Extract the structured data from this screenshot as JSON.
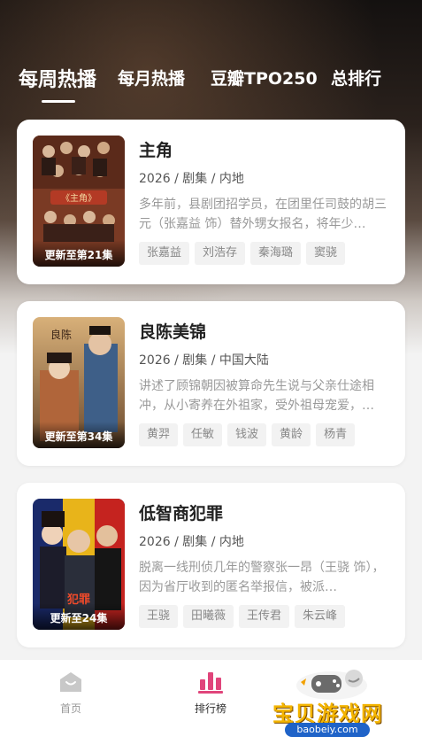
{
  "tabs": [
    {
      "label": "每周热播",
      "active": true
    },
    {
      "label": "每月热播",
      "active": false
    },
    {
      "label": "豆瓣TPO250",
      "active": false
    },
    {
      "label": "总排行",
      "active": false
    }
  ],
  "items": [
    {
      "title": "主角",
      "meta": "2026 / 剧集 / 内地",
      "description": "多年前，县剧团招学员，在团里任司鼓的胡三元（张嘉益 饰）替外甥女报名，将年少…",
      "badge": "更新至第21集",
      "actors": [
        "张嘉益",
        "刘浩存",
        "秦海璐",
        "窦骁"
      ]
    },
    {
      "title": "良陈美锦",
      "meta": "2026 / 剧集 / 中国大陆",
      "description": "讲述了顾锦朝因被算命先生说与父亲仕途相冲，从小寄养在外祖家，受外祖母宠爱，…",
      "badge": "更新至第34集",
      "actors": [
        "黄羿",
        "任敏",
        "钱波",
        "黄龄",
        "杨青"
      ]
    },
    {
      "title": "低智商犯罪",
      "meta": "2026 / 剧集 / 内地",
      "description": "脱离一线刑侦几年的警察张一昂（王骁 饰），因为省厅收到的匿名举报信，被派…",
      "badge": "更新至24集",
      "actors": [
        "王骁",
        "田曦薇",
        "王传君",
        "朱云峰"
      ]
    }
  ],
  "bottom_nav": {
    "home": "首页",
    "rank": "排行榜"
  },
  "watermark": {
    "text": "宝贝游戏网",
    "url": "baobeiy.com"
  },
  "colors": {
    "accent": "#e0457b",
    "card_bg": "#ffffff",
    "page_bg": "#f3f3f3"
  }
}
